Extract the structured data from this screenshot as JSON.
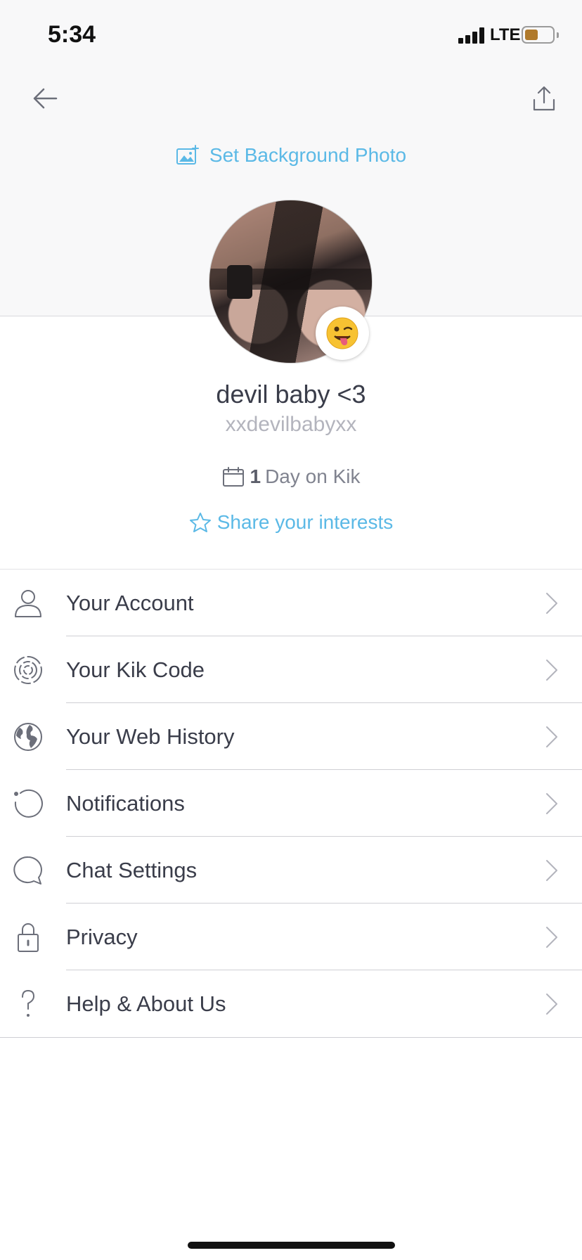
{
  "status_bar": {
    "time": "5:34",
    "network": "LTE",
    "battery_color": "#b07a2c"
  },
  "header": {
    "back_icon": "arrow-left-icon",
    "share_icon": "share-icon",
    "set_background_label": "Set Background Photo"
  },
  "profile": {
    "display_name": "devil baby <3",
    "username": "xxdevilbabyxx",
    "days_count": "1",
    "days_label": "Day on Kik",
    "interests_label": "Share your interests",
    "accent_color": "#5bb9e6"
  },
  "menu": {
    "items": [
      {
        "label": "Your Account",
        "icon": "person-icon"
      },
      {
        "label": "Your Kik Code",
        "icon": "kik-code-icon"
      },
      {
        "label": "Your Web History",
        "icon": "globe-icon"
      },
      {
        "label": "Notifications",
        "icon": "notification-icon"
      },
      {
        "label": "Chat Settings",
        "icon": "chat-bubble-icon"
      },
      {
        "label": "Privacy",
        "icon": "lock-icon"
      },
      {
        "label": "Help & About Us",
        "icon": "question-icon"
      }
    ]
  }
}
